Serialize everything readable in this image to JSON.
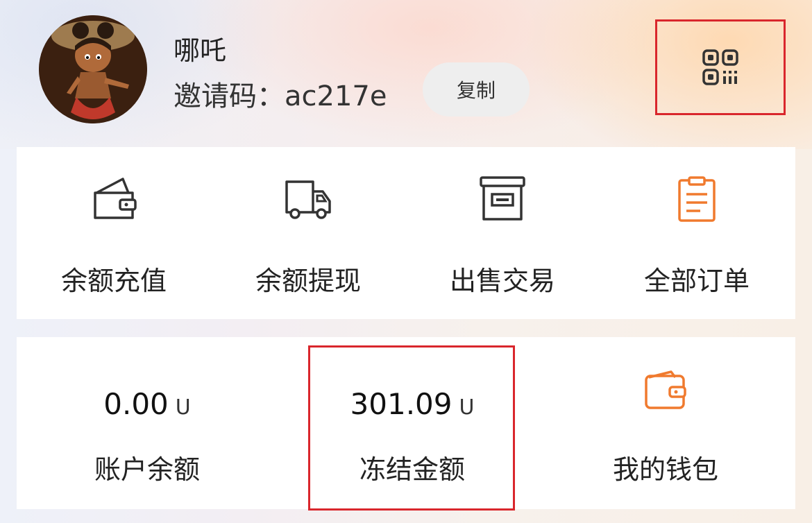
{
  "profile": {
    "username": "哪吒",
    "invite_label": "邀请码：",
    "invite_code": "ac217e",
    "copy_label": "复制"
  },
  "menu": {
    "items": [
      {
        "label": "余额充值",
        "icon": "wallet-icon"
      },
      {
        "label": "余额提现",
        "icon": "truck-icon"
      },
      {
        "label": "出售交易",
        "icon": "archive-box-icon"
      },
      {
        "label": "全部订单",
        "icon": "clipboard-icon"
      }
    ]
  },
  "stats": {
    "balance": {
      "value": "0.00",
      "unit": "U",
      "label": "账户余额"
    },
    "frozen": {
      "value": "301.09",
      "unit": "U",
      "label": "冻结金额"
    },
    "wallet": {
      "label": "我的钱包",
      "icon": "wallet-icon"
    }
  },
  "colors": {
    "accent_orange": "#f07a2e",
    "highlight_red": "#d9262c",
    "icon_dark": "#333333"
  }
}
